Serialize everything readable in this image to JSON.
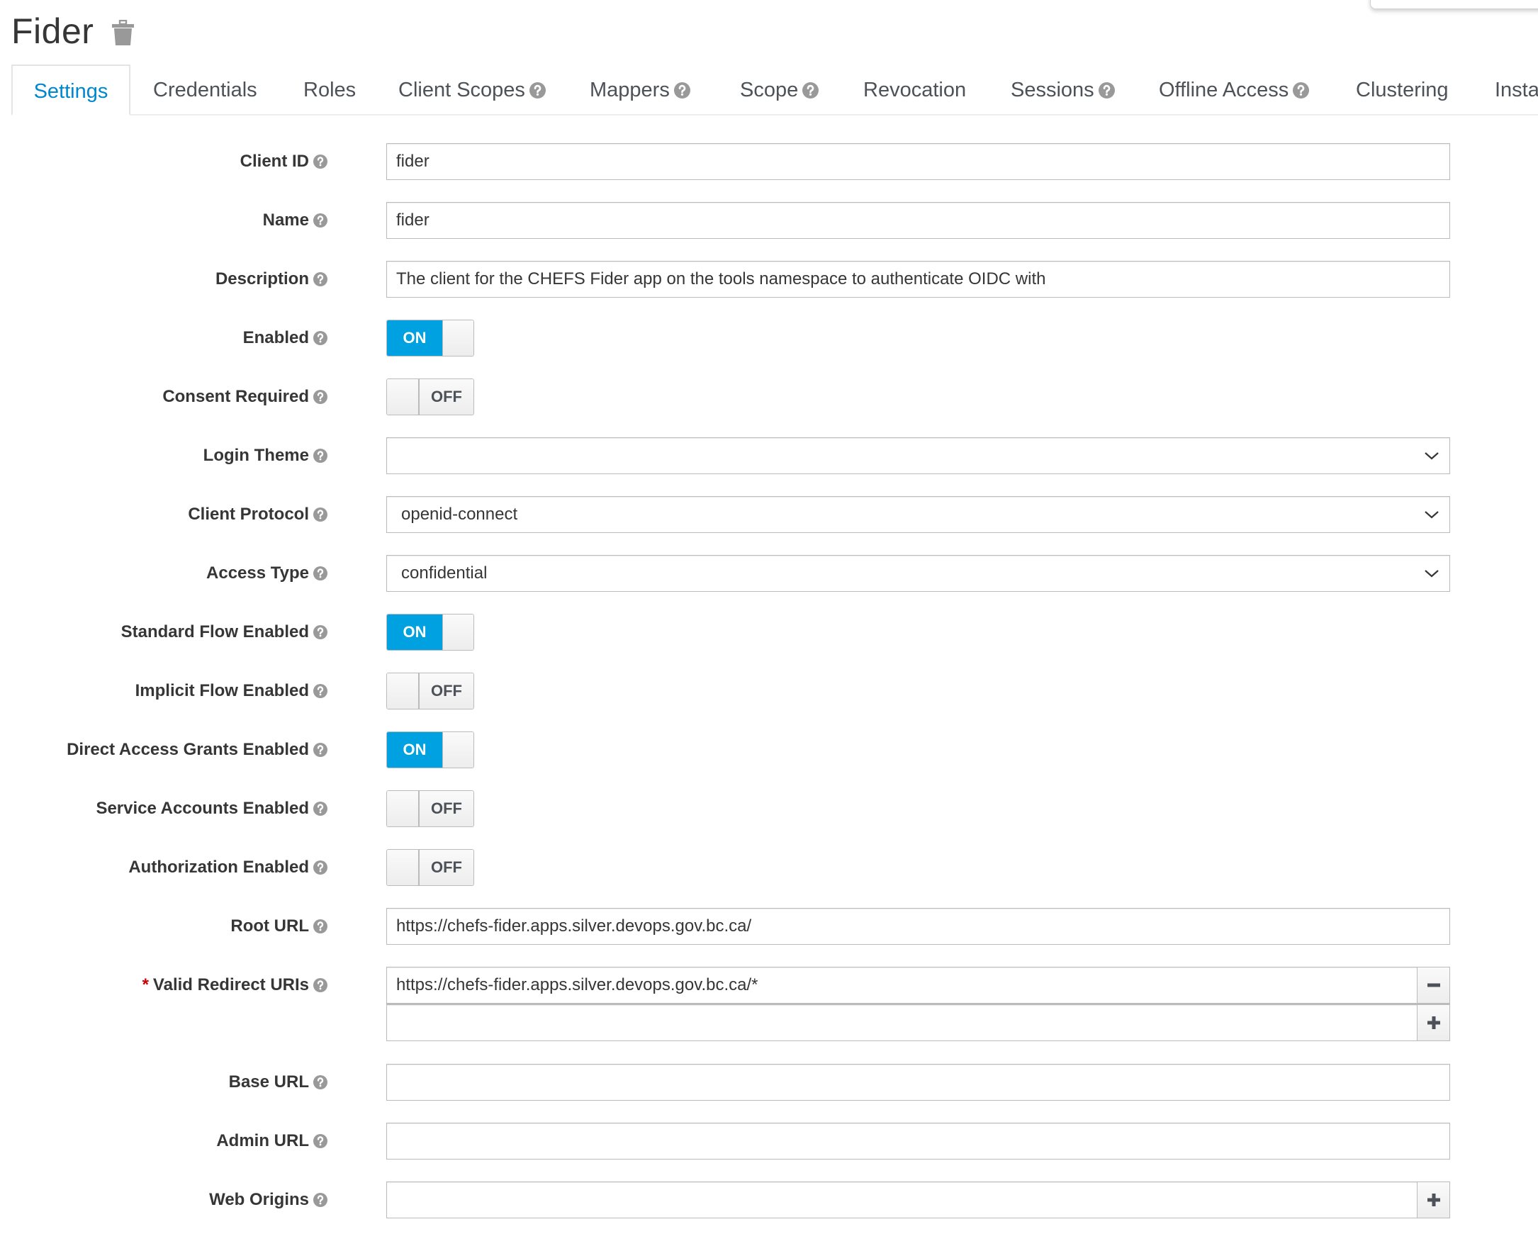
{
  "header": {
    "title": "Fider",
    "delete_icon": "trash-icon"
  },
  "tabs": [
    {
      "label": "Settings",
      "active": true,
      "help": false
    },
    {
      "label": "Credentials",
      "active": false,
      "help": false
    },
    {
      "label": "Roles",
      "active": false,
      "help": false
    },
    {
      "label": "Client Scopes",
      "active": false,
      "help": true
    },
    {
      "label": "Mappers",
      "active": false,
      "help": true
    },
    {
      "label": "Scope",
      "active": false,
      "help": true
    },
    {
      "label": "Revocation",
      "active": false,
      "help": false
    },
    {
      "label": "Sessions",
      "active": false,
      "help": true
    },
    {
      "label": "Offline Access",
      "active": false,
      "help": true
    },
    {
      "label": "Clustering",
      "active": false,
      "help": false
    },
    {
      "label": "Insta",
      "active": false,
      "help": false
    }
  ],
  "form": {
    "client_id": {
      "label": "Client ID",
      "value": "fider"
    },
    "name": {
      "label": "Name",
      "value": "fider"
    },
    "description": {
      "label": "Description",
      "value": "The client for the CHEFS Fider app on the tools namespace to authenticate OIDC with"
    },
    "enabled": {
      "label": "Enabled",
      "state": "ON"
    },
    "consent_required": {
      "label": "Consent Required",
      "state": "OFF"
    },
    "login_theme": {
      "label": "Login Theme",
      "value": ""
    },
    "client_protocol": {
      "label": "Client Protocol",
      "value": "openid-connect"
    },
    "access_type": {
      "label": "Access Type",
      "value": "confidential"
    },
    "standard_flow": {
      "label": "Standard Flow Enabled",
      "state": "ON"
    },
    "implicit_flow": {
      "label": "Implicit Flow Enabled",
      "state": "OFF"
    },
    "direct_access": {
      "label": "Direct Access Grants Enabled",
      "state": "ON"
    },
    "service_accounts": {
      "label": "Service Accounts Enabled",
      "state": "OFF"
    },
    "authorization": {
      "label": "Authorization Enabled",
      "state": "OFF"
    },
    "root_url": {
      "label": "Root URL",
      "value": "https://chefs-fider.apps.silver.devops.gov.bc.ca/"
    },
    "valid_redirect_uris": {
      "label": "Valid Redirect URIs",
      "required_mark": "*",
      "values": [
        "https://chefs-fider.apps.silver.devops.gov.bc.ca/*",
        ""
      ]
    },
    "base_url": {
      "label": "Base URL",
      "value": ""
    },
    "admin_url": {
      "label": "Admin URL",
      "value": ""
    },
    "web_origins": {
      "label": "Web Origins",
      "value": ""
    }
  },
  "colors": {
    "accent": "#0088ce",
    "toggle_on": "#00a1e0",
    "required": "#cc0000",
    "help_icon": "#999999"
  }
}
